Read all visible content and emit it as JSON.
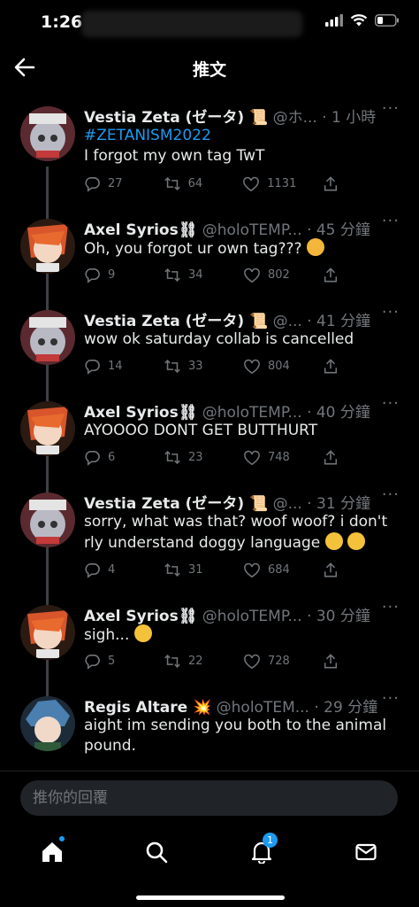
{
  "status": {
    "time": "1:26"
  },
  "header": {
    "title": "推文"
  },
  "tweets": [
    {
      "name": "Vestia Zeta (ゼータ) 📜",
      "handle": "@ホ...",
      "time": "· 1 小時",
      "hashtag": "#ZETANISM2022",
      "text": "I forgot my own tag TwT",
      "replies": "27",
      "retweets": "64",
      "likes": "1131"
    },
    {
      "name": "Axel Syrios⛓",
      "handle": "@holoTEMP...",
      "time": "· 45 分鐘",
      "hashtag": "",
      "text": "Oh, you forgot ur own tag???",
      "replies": "9",
      "retweets": "34",
      "likes": "802"
    },
    {
      "name": "Vestia Zeta (ゼータ) 📜",
      "handle": "@...",
      "time": "· 41 分鐘",
      "hashtag": "",
      "text": "wow ok saturday collab is cancelled",
      "replies": "14",
      "retweets": "33",
      "likes": "804"
    },
    {
      "name": "Axel Syrios⛓",
      "handle": "@holoTEMP...",
      "time": "· 40 分鐘",
      "hashtag": "",
      "text": "AYOOOO DONT GET BUTTHURT",
      "replies": "6",
      "retweets": "23",
      "likes": "748"
    },
    {
      "name": "Vestia Zeta (ゼータ) 📜",
      "handle": "@...",
      "time": "· 31 分鐘",
      "hashtag": "",
      "text": "sorry, what was that? woof woof? i don't rly understand doggy language",
      "replies": "4",
      "retweets": "31",
      "likes": "684"
    },
    {
      "name": "Axel Syrios⛓",
      "handle": "@holoTEMP...",
      "time": "· 30 分鐘",
      "hashtag": "",
      "text": "sigh...",
      "replies": "5",
      "retweets": "22",
      "likes": "728"
    },
    {
      "name": "Regis Altare 💥",
      "handle": "@holoTEM...",
      "time": "· 29 分鐘",
      "hashtag": "",
      "text": "aight im sending you both to the animal pound.",
      "replies": "",
      "retweets": "",
      "likes": ""
    }
  ],
  "more_label": "···",
  "reply": {
    "placeholder": "推你的回覆"
  },
  "tabs": {
    "notifications_badge": "1"
  },
  "colors": {
    "accent": "#1d9bf0",
    "background": "#000000",
    "muted": "#71767b"
  }
}
